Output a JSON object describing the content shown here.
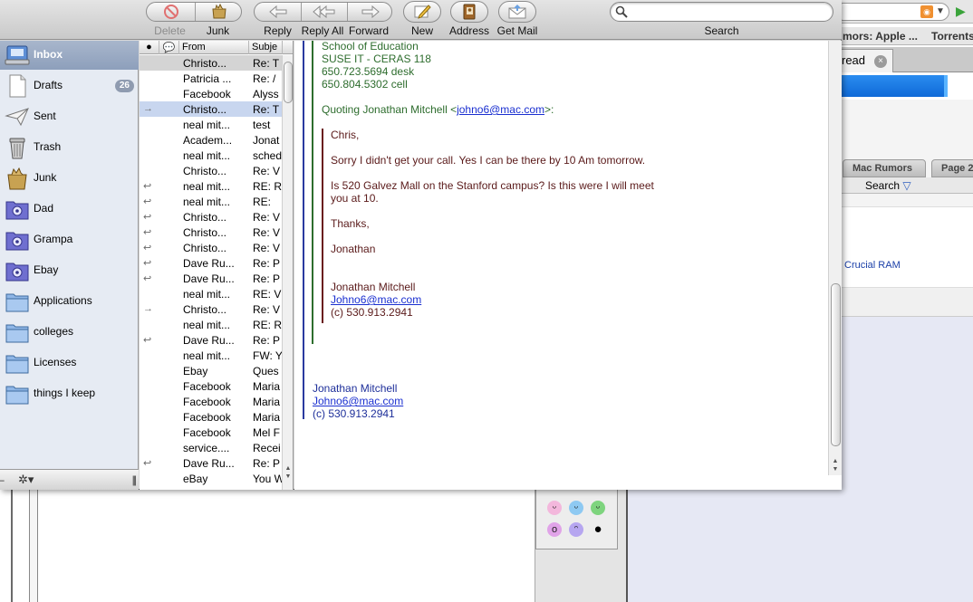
{
  "toolbar": {
    "delete_label": "Delete",
    "junk_label": "Junk",
    "reply_label": "Reply",
    "reply_all_label": "Reply All",
    "forward_label": "Forward",
    "new_label": "New",
    "address_label": "Address",
    "get_mail_label": "Get Mail",
    "search_label": "Search",
    "search_value": ""
  },
  "sidebar": {
    "items": [
      {
        "label": "Inbox",
        "icon": "inbox-icon",
        "badge": ""
      },
      {
        "label": "Drafts",
        "icon": "drafts-icon",
        "badge": "26"
      },
      {
        "label": "Sent",
        "icon": "sent-icon",
        "badge": ""
      },
      {
        "label": "Trash",
        "icon": "trash-icon",
        "badge": ""
      },
      {
        "label": "Junk",
        "icon": "junk-icon",
        "badge": ""
      },
      {
        "label": "Dad",
        "icon": "smart-folder-icon",
        "badge": ""
      },
      {
        "label": "Grampa",
        "icon": "smart-folder-icon",
        "badge": ""
      },
      {
        "label": "Ebay",
        "icon": "smart-folder-icon",
        "badge": ""
      },
      {
        "label": "Applications",
        "icon": "folder-icon",
        "badge": ""
      },
      {
        "label": "colleges",
        "icon": "folder-icon",
        "badge": ""
      },
      {
        "label": "Licenses",
        "icon": "folder-icon",
        "badge": ""
      },
      {
        "label": "things I keep",
        "icon": "folder-icon",
        "badge": ""
      }
    ]
  },
  "message_list": {
    "columns": [
      "From",
      "Subje"
    ],
    "rows": [
      {
        "status": "",
        "from": "Christo...",
        "subject": "Re: T"
      },
      {
        "status": "",
        "from": "Patricia ...",
        "subject": "Re: /"
      },
      {
        "status": "",
        "from": "Facebook",
        "subject": "Alyss"
      },
      {
        "status": "forwarded",
        "from": "Christo...",
        "subject": "Re: T"
      },
      {
        "status": "",
        "from": "neal mit...",
        "subject": "test"
      },
      {
        "status": "",
        "from": "Academ...",
        "subject": "Jonat"
      },
      {
        "status": "",
        "from": "neal mit...",
        "subject": "sched"
      },
      {
        "status": "",
        "from": "Christo...",
        "subject": "Re: V"
      },
      {
        "status": "replied",
        "from": "neal mit...",
        "subject": "RE: R"
      },
      {
        "status": "replied",
        "from": "neal mit...",
        "subject": "RE:"
      },
      {
        "status": "replied",
        "from": "Christo...",
        "subject": "Re: V"
      },
      {
        "status": "replied",
        "from": "Christo...",
        "subject": "Re: V"
      },
      {
        "status": "replied",
        "from": "Christo...",
        "subject": "Re: V"
      },
      {
        "status": "replied",
        "from": "Dave Ru...",
        "subject": "Re: P"
      },
      {
        "status": "replied",
        "from": "Dave Ru...",
        "subject": "Re: P"
      },
      {
        "status": "",
        "from": "neal mit...",
        "subject": "RE: V"
      },
      {
        "status": "forwarded",
        "from": "Christo...",
        "subject": "Re: V"
      },
      {
        "status": "",
        "from": "neal mit...",
        "subject": "RE: R"
      },
      {
        "status": "replied",
        "from": "Dave Ru...",
        "subject": "Re: P"
      },
      {
        "status": "",
        "from": "neal mit...",
        "subject": "FW: Y"
      },
      {
        "status": "",
        "from": "Ebay",
        "subject": "Ques"
      },
      {
        "status": "",
        "from": "Facebook",
        "subject": "Maria"
      },
      {
        "status": "",
        "from": "Facebook",
        "subject": "Maria"
      },
      {
        "status": "",
        "from": "Facebook",
        "subject": "Maria"
      },
      {
        "status": "",
        "from": "Facebook",
        "subject": "Mel F"
      },
      {
        "status": "",
        "from": "service....",
        "subject": "Recei"
      },
      {
        "status": "replied",
        "from": "Dave Ru...",
        "subject": "Re: P"
      },
      {
        "status": "",
        "from": "eBay",
        "subject": "You W"
      }
    ]
  },
  "message": {
    "green_lines": [
      "School of Education",
      "SUSE IT - CERAS 118",
      "650.723.5694 desk",
      "650.804.5302 cell"
    ],
    "quoting_prefix": "Quoting Jonathan Mitchell <",
    "quoting_email": "johno6@mac.com",
    "quoting_suffix": ">:",
    "greeting": "Chris,",
    "para1": "Sorry I didn't get your call. Yes I can be there by 10 Am tomorrow.",
    "para2_line1": "Is 520 Galvez Mall on the Stanford campus? Is this were I will meet",
    "para2_line2": "you at 10.",
    "thanks": "Thanks,",
    "signoff": "Jonathan",
    "inner_sig_name": "Jonathan Mitchell",
    "inner_sig_email": "Johno6@mac.com",
    "inner_sig_phone": "(c) 530.913.2941",
    "outer_sig_name": "Jonathan Mitchell",
    "outer_sig_email": "Johno6@mac.com",
    "outer_sig_phone": "(c) 530.913.2941"
  },
  "background_browser": {
    "bookmark_1": "mors: Apple ...",
    "bookmark_2": "Torrents",
    "tab_label": "read",
    "subtab_1": "Mac Rumors",
    "subtab_2": "Page 2",
    "search_label": "Search",
    "link_text": "Crucial RAM"
  },
  "colors": {
    "quote_level_1": "#2a3aa0",
    "quote_level_2": "#2d6e2d",
    "quote_level_3": "#6a1a1a",
    "sidebar_selected": "#8d9fbb"
  }
}
